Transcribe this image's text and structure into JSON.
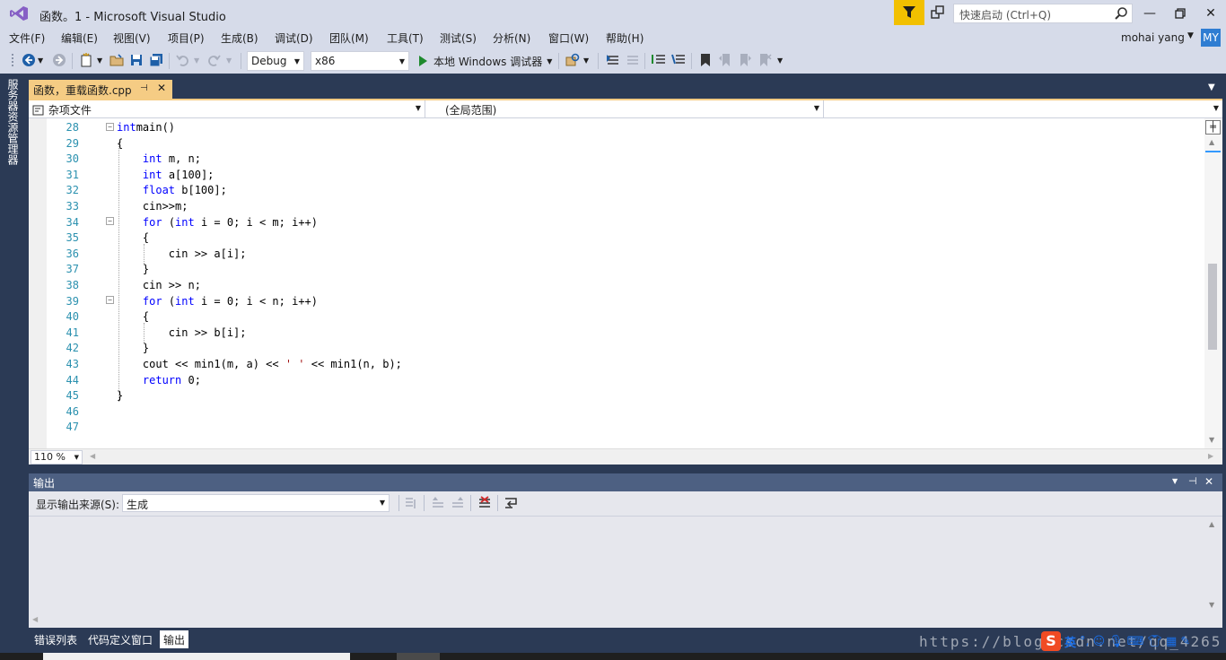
{
  "window": {
    "title": "函数。1 - Microsoft Visual Studio",
    "quick_launch_placeholder": "快速启动 (Ctrl+Q)"
  },
  "menu": [
    "文件(F)",
    "编辑(E)",
    "视图(V)",
    "项目(P)",
    "生成(B)",
    "调试(D)",
    "团队(M)",
    "工具(T)",
    "测试(S)",
    "分析(N)",
    "窗口(W)",
    "帮助(H)"
  ],
  "user": {
    "name": "mohai yang",
    "initials": "MY"
  },
  "toolbar": {
    "config": "Debug",
    "platform": "x86",
    "run_label": "本地 Windows 调试器"
  },
  "side_panel_label": "服务器资源管理器",
  "document_tab": {
    "name": "函数，重载函数.cpp"
  },
  "nav": {
    "project": "杂项文件",
    "scope": "(全局范围)",
    "member": ""
  },
  "code": [
    {
      "ln": "28",
      "parts": [
        [
          "kw",
          "int"
        ],
        [
          "",
          "main()"
        ]
      ]
    },
    {
      "ln": "29",
      "parts": [
        [
          "",
          "{"
        ]
      ]
    },
    {
      "ln": "30",
      "parts": [
        [
          "",
          "    "
        ],
        [
          "kw",
          "int"
        ],
        [
          "",
          " m, n;"
        ]
      ]
    },
    {
      "ln": "31",
      "parts": [
        [
          "",
          "    "
        ],
        [
          "kw",
          "int"
        ],
        [
          "",
          " a[100];"
        ]
      ]
    },
    {
      "ln": "32",
      "parts": [
        [
          "",
          "    "
        ],
        [
          "kw",
          "float"
        ],
        [
          "",
          " b[100];"
        ]
      ]
    },
    {
      "ln": "33",
      "parts": [
        [
          "",
          "    cin>>m;"
        ]
      ]
    },
    {
      "ln": "34",
      "parts": [
        [
          "",
          "    "
        ],
        [
          "kw",
          "for"
        ],
        [
          "",
          " ("
        ],
        [
          "kw",
          "int"
        ],
        [
          "",
          " i = 0; i < m; i++)"
        ]
      ]
    },
    {
      "ln": "35",
      "parts": [
        [
          "",
          "    {"
        ]
      ]
    },
    {
      "ln": "36",
      "parts": [
        [
          "",
          "        cin >> a[i];"
        ]
      ]
    },
    {
      "ln": "37",
      "parts": [
        [
          "",
          "    }"
        ]
      ]
    },
    {
      "ln": "38",
      "parts": [
        [
          "",
          "    cin >> n;"
        ]
      ]
    },
    {
      "ln": "39",
      "parts": [
        [
          "",
          "    "
        ],
        [
          "kw",
          "for"
        ],
        [
          "",
          " ("
        ],
        [
          "kw",
          "int"
        ],
        [
          "",
          " i = 0; i < n; i++)"
        ]
      ]
    },
    {
      "ln": "40",
      "parts": [
        [
          "",
          "    {"
        ]
      ]
    },
    {
      "ln": "41",
      "parts": [
        [
          "",
          "        cin >> b[i];"
        ]
      ]
    },
    {
      "ln": "42",
      "parts": [
        [
          "",
          "    }"
        ]
      ]
    },
    {
      "ln": "43",
      "parts": [
        [
          "",
          "    cout << min1(m, a) << "
        ],
        [
          "str",
          "' '"
        ],
        [
          "",
          " << min1(n, b);"
        ]
      ]
    },
    {
      "ln": "44",
      "parts": [
        [
          "",
          "    "
        ],
        [
          "kw",
          "return"
        ],
        [
          "",
          " 0;"
        ]
      ]
    },
    {
      "ln": "45",
      "parts": [
        [
          "",
          "}"
        ]
      ]
    },
    {
      "ln": "46",
      "parts": []
    },
    {
      "ln": "47",
      "parts": []
    }
  ],
  "editor": {
    "zoom": "110 %"
  },
  "output": {
    "title": "输出",
    "source_label": "显示输出来源(S):",
    "source_value": "生成"
  },
  "bottom_tabs": [
    "错误列表",
    "代码定义窗口",
    "输出"
  ],
  "watermark": "https://blog.csdn.net/qq_4265",
  "ime": {
    "lang": "英"
  },
  "colors": {
    "accent": "#f5cc84",
    "filter": "#f2c000",
    "avatar": "#2f7dd2",
    "panel_title": "#4d6082"
  }
}
